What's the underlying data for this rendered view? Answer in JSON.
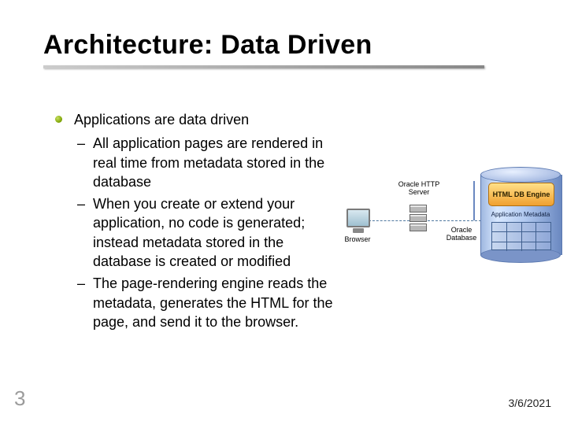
{
  "title": "Architecture: Data Driven",
  "bullets": {
    "top": "Applications are data driven",
    "subs": [
      "All application pages are rendered in real time from metadata stored in the database",
      "When you create or extend your application, no code is generated; instead metadata stored in the database is created or modified",
      "The page-rendering engine reads the metadata, generates the HTML for the page, and send it to the browser."
    ]
  },
  "diagram": {
    "browser": "Browser",
    "http_server": "Oracle HTTP Server",
    "oracle_db": "Oracle Database",
    "engine": "HTML DB Engine",
    "metadata": "Application Metadata"
  },
  "footer": {
    "slide_number": "3",
    "date": "3/6/2021"
  }
}
